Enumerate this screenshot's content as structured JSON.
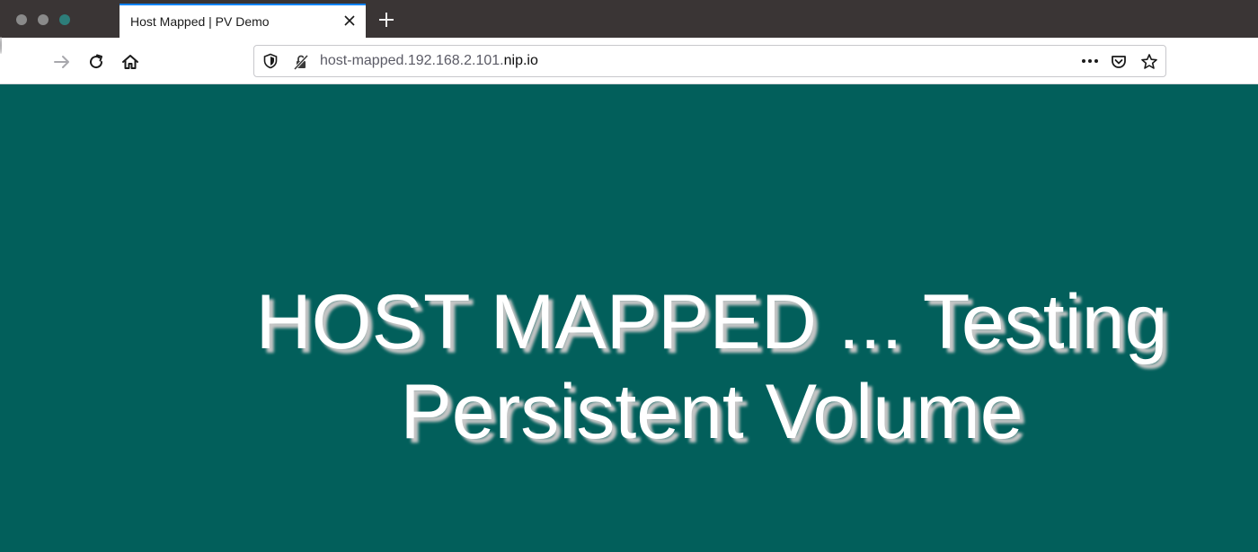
{
  "window": {
    "tab": {
      "title": "Host Mapped | PV Demo"
    }
  },
  "toolbar": {
    "url_prefix": "host-mapped.192.168.2.101.",
    "url_domain": "nip.io"
  },
  "page": {
    "heading_line1": "HOST MAPPED ... Testing",
    "heading_line2": "Persistent Volume",
    "background_color": "#025f5b",
    "text_color": "#ffffff"
  },
  "icons": {
    "tab_close": "close-icon",
    "new_tab": "plus-icon",
    "back": "arrow-left-icon",
    "forward": "arrow-right-icon",
    "reload": "reload-icon",
    "home": "home-icon",
    "tracking": "shield-icon",
    "connection": "insecure-lock-icon",
    "page_actions": "more-icon",
    "pocket": "pocket-icon",
    "bookmark": "star-icon"
  }
}
